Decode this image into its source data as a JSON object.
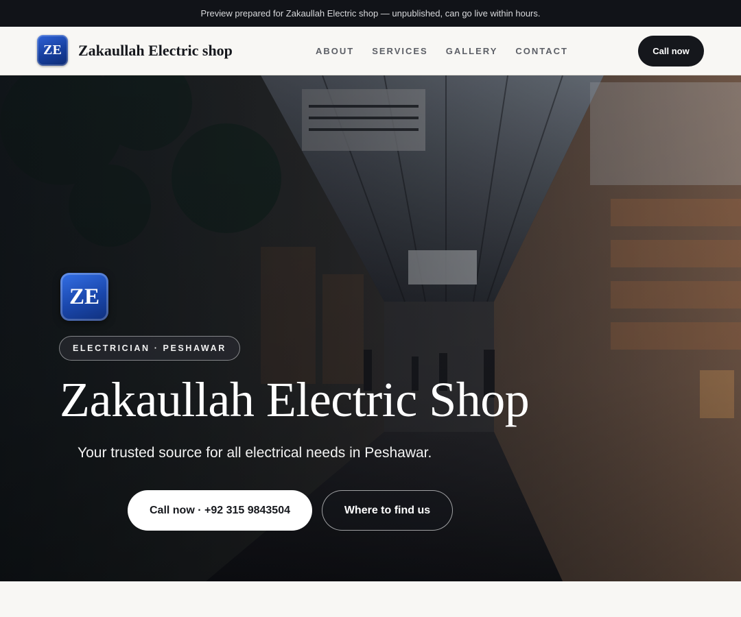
{
  "banner": {
    "text": "Preview prepared for Zakaullah Electric shop — unpublished, can go live within hours."
  },
  "header": {
    "logo_text": "ZE",
    "brand_name": "Zakaullah Electric shop",
    "nav": [
      {
        "label": "ABOUT"
      },
      {
        "label": "SERVICES"
      },
      {
        "label": "GALLERY"
      },
      {
        "label": "CONTACT"
      }
    ],
    "cta_label": "Call now"
  },
  "hero": {
    "logo_text": "ZE",
    "tag": "ELECTRICIAN · PESHAWAR",
    "title": "Zakaullah Electric Shop",
    "subtitle": "Your trusted source for all electrical needs in Peshawar.",
    "primary_button": "Call now · +92 315 9843504",
    "secondary_button": "Where to find us",
    "background_image": "market-corridor-photo"
  },
  "colors": {
    "dark": "#111318",
    "logo_blue": "#1a47ac",
    "page_bg": "#f8f7f4",
    "white": "#ffffff"
  }
}
